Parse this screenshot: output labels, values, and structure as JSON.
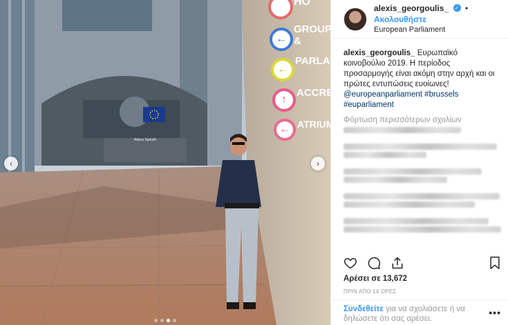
{
  "photo": {
    "signs": [
      "HO",
      "GROUP &",
      "PARLAME",
      "ACCRED",
      "ATRIUM"
    ],
    "building_sign": "Altiero Spinelli"
  },
  "header": {
    "username": "alexis_georgoulis_",
    "separator": "•",
    "follow_label": "Ακολουθήστε",
    "location": "European Parliament"
  },
  "caption": {
    "username": "alexis_georgoulis_",
    "text": "Ευρωπαϊκό κοινοβούλιο 2019. Η περίοδος προσαρμογής είναι ακόμη στην αρχή και οι πρώτες εντυπώσεις ευοίωνες!",
    "mention": "@europeanparliament",
    "hashtag1": "#brussels",
    "hashtag2": "#euparliament"
  },
  "load_more": "Φόρτωση περισσότερων σχολίων",
  "likes": "Αρέσει σε 13,672",
  "time": "ΠΡΙΝ ΑΠΟ 14 ΩΡΕΣ",
  "footer": {
    "login_link": "Συνδεθείτε",
    "text": " για να σχολιάσετε ή να δηλώσετε ότι σας αρέσει.",
    "more": "•••"
  },
  "colors": {
    "accent": "#3897f0",
    "link": "#003569"
  }
}
